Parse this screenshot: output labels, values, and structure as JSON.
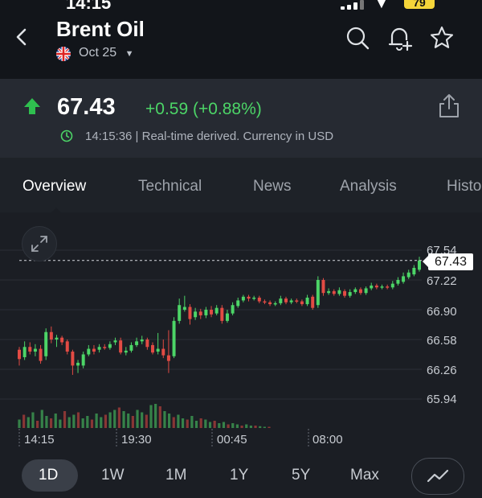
{
  "status_bar": {
    "time": "14:15",
    "battery": "79"
  },
  "header": {
    "title": "Brent Oil",
    "contract": "Oct 25"
  },
  "quote": {
    "price": "67.43",
    "change": "+0.59 (+0.88%)",
    "realtime_text": "14:15:36 | Real-time derived. Currency in USD",
    "colors": {
      "up": "#4cd567",
      "down": "#e34b44"
    }
  },
  "tabs": [
    "Overview",
    "Technical",
    "News",
    "Analysis",
    "Histo"
  ],
  "chart_data": {
    "type": "candlestick",
    "price_tag": "67.43",
    "y_ticks": [
      "67.54",
      "67.22",
      "66.90",
      "66.58",
      "66.26",
      "65.94"
    ],
    "x_ticks": [
      "14:15",
      "19:30",
      "00:45",
      "08:00"
    ],
    "ylim": [
      65.94,
      67.54
    ],
    "grid": true,
    "candles": [
      {
        "o": 66.47,
        "c": 66.37,
        "h": 66.5,
        "l": 66.3
      },
      {
        "o": 66.39,
        "c": 66.5,
        "h": 66.56,
        "l": 66.36
      },
      {
        "o": 66.5,
        "c": 66.45,
        "h": 66.55,
        "l": 66.42
      },
      {
        "o": 66.45,
        "c": 66.48,
        "h": 66.53,
        "l": 66.4
      },
      {
        "o": 66.48,
        "c": 66.35,
        "h": 66.52,
        "l": 66.32
      },
      {
        "o": 66.4,
        "c": 66.66,
        "h": 66.7,
        "l": 66.36
      },
      {
        "o": 66.66,
        "c": 66.58,
        "h": 66.72,
        "l": 66.54
      },
      {
        "o": 66.58,
        "c": 66.6,
        "h": 66.63,
        "l": 66.5
      },
      {
        "o": 66.6,
        "c": 66.55,
        "h": 66.62,
        "l": 66.52
      },
      {
        "o": 66.56,
        "c": 66.45,
        "h": 66.58,
        "l": 66.42
      },
      {
        "o": 66.45,
        "c": 66.3,
        "h": 66.47,
        "l": 66.2
      },
      {
        "o": 66.3,
        "c": 66.33,
        "h": 66.36,
        "l": 66.22
      },
      {
        "o": 66.3,
        "c": 66.42,
        "h": 66.45,
        "l": 66.27
      },
      {
        "o": 66.42,
        "c": 66.48,
        "h": 66.52,
        "l": 66.4
      },
      {
        "o": 66.48,
        "c": 66.45,
        "h": 66.52,
        "l": 66.42
      },
      {
        "o": 66.47,
        "c": 66.5,
        "h": 66.53,
        "l": 66.44
      },
      {
        "o": 66.5,
        "c": 66.49,
        "h": 66.53,
        "l": 66.47
      },
      {
        "o": 66.49,
        "c": 66.53,
        "h": 66.56,
        "l": 66.47
      },
      {
        "o": 66.55,
        "c": 66.57,
        "h": 66.6,
        "l": 66.52
      },
      {
        "o": 66.57,
        "c": 66.44,
        "h": 66.6,
        "l": 66.42
      },
      {
        "o": 66.44,
        "c": 66.46,
        "h": 66.5,
        "l": 66.41
      },
      {
        "o": 66.46,
        "c": 66.52,
        "h": 66.55,
        "l": 66.44
      },
      {
        "o": 66.52,
        "c": 66.56,
        "h": 66.6,
        "l": 66.5
      },
      {
        "o": 66.56,
        "c": 66.58,
        "h": 66.62,
        "l": 66.53
      },
      {
        "o": 66.58,
        "c": 66.5,
        "h": 66.6,
        "l": 66.47
      },
      {
        "o": 66.52,
        "c": 66.44,
        "h": 66.55,
        "l": 66.42
      },
      {
        "o": 66.45,
        "c": 66.48,
        "h": 66.65,
        "l": 66.42
      },
      {
        "o": 66.48,
        "c": 66.41,
        "h": 66.58,
        "l": 66.38
      },
      {
        "o": 66.41,
        "c": 66.35,
        "h": 66.68,
        "l": 66.22
      },
      {
        "o": 66.4,
        "c": 66.78,
        "h": 66.82,
        "l": 66.38
      },
      {
        "o": 66.78,
        "c": 66.95,
        "h": 67.02,
        "l": 66.75
      },
      {
        "o": 66.9,
        "c": 66.93,
        "h": 67.05,
        "l": 66.88
      },
      {
        "o": 66.93,
        "c": 66.8,
        "h": 66.96,
        "l": 66.74
      },
      {
        "o": 66.82,
        "c": 66.88,
        "h": 66.92,
        "l": 66.79
      },
      {
        "o": 66.88,
        "c": 66.84,
        "h": 66.91,
        "l": 66.8
      },
      {
        "o": 66.84,
        "c": 66.9,
        "h": 66.93,
        "l": 66.81
      },
      {
        "o": 66.9,
        "c": 66.85,
        "h": 66.94,
        "l": 66.82
      },
      {
        "o": 66.86,
        "c": 66.92,
        "h": 66.95,
        "l": 66.84
      },
      {
        "o": 66.92,
        "c": 66.78,
        "h": 66.95,
        "l": 66.75
      },
      {
        "o": 66.78,
        "c": 66.86,
        "h": 66.9,
        "l": 66.76
      },
      {
        "o": 66.86,
        "c": 66.95,
        "h": 66.98,
        "l": 66.84
      },
      {
        "o": 66.94,
        "c": 67.0,
        "h": 67.03,
        "l": 66.92
      },
      {
        "o": 67.0,
        "c": 67.04,
        "h": 67.06,
        "l": 66.98
      },
      {
        "o": 67.04,
        "c": 67.02,
        "h": 67.06,
        "l": 66.99
      },
      {
        "o": 67.02,
        "c": 67.03,
        "h": 67.05,
        "l": 67.0
      },
      {
        "o": 67.03,
        "c": 66.99,
        "h": 67.05,
        "l": 66.97
      },
      {
        "o": 66.99,
        "c": 66.98,
        "h": 67.01,
        "l": 66.96
      },
      {
        "o": 66.98,
        "c": 66.96,
        "h": 67.0,
        "l": 66.94
      },
      {
        "o": 66.96,
        "c": 66.97,
        "h": 66.99,
        "l": 66.94
      },
      {
        "o": 66.97,
        "c": 67.02,
        "h": 67.05,
        "l": 66.95
      },
      {
        "o": 67.02,
        "c": 66.98,
        "h": 67.04,
        "l": 66.96
      },
      {
        "o": 66.98,
        "c": 67.0,
        "h": 67.02,
        "l": 66.96
      },
      {
        "o": 67.0,
        "c": 66.99,
        "h": 67.02,
        "l": 66.97
      },
      {
        "o": 66.99,
        "c": 66.96,
        "h": 67.01,
        "l": 66.94
      },
      {
        "o": 66.96,
        "c": 67.03,
        "h": 67.06,
        "l": 66.94
      },
      {
        "o": 67.04,
        "c": 66.92,
        "h": 67.06,
        "l": 66.9
      },
      {
        "o": 66.95,
        "c": 67.22,
        "h": 67.26,
        "l": 66.92
      },
      {
        "o": 67.22,
        "c": 67.08,
        "h": 67.24,
        "l": 67.05
      },
      {
        "o": 67.08,
        "c": 67.1,
        "h": 67.13,
        "l": 67.06
      },
      {
        "o": 67.1,
        "c": 67.07,
        "h": 67.12,
        "l": 67.05
      },
      {
        "o": 67.07,
        "c": 67.11,
        "h": 67.14,
        "l": 67.05
      },
      {
        "o": 67.1,
        "c": 67.05,
        "h": 67.12,
        "l": 67.03
      },
      {
        "o": 67.05,
        "c": 67.09,
        "h": 67.12,
        "l": 67.03
      },
      {
        "o": 67.09,
        "c": 67.12,
        "h": 67.14,
        "l": 67.07
      },
      {
        "o": 67.12,
        "c": 67.08,
        "h": 67.14,
        "l": 67.06
      },
      {
        "o": 67.08,
        "c": 67.13,
        "h": 67.15,
        "l": 67.06
      },
      {
        "o": 67.13,
        "c": 67.16,
        "h": 67.19,
        "l": 67.11
      },
      {
        "o": 67.16,
        "c": 67.14,
        "h": 67.18,
        "l": 67.12
      },
      {
        "o": 67.14,
        "c": 67.15,
        "h": 67.17,
        "l": 67.12
      },
      {
        "o": 67.15,
        "c": 67.14,
        "h": 67.17,
        "l": 67.12
      },
      {
        "o": 67.14,
        "c": 67.18,
        "h": 67.21,
        "l": 67.12
      },
      {
        "o": 67.18,
        "c": 67.22,
        "h": 67.25,
        "l": 67.16
      },
      {
        "o": 67.2,
        "c": 67.26,
        "h": 67.3,
        "l": 67.18
      },
      {
        "o": 67.25,
        "c": 67.3,
        "h": 67.33,
        "l": 67.23
      },
      {
        "o": 67.28,
        "c": 67.35,
        "h": 67.38,
        "l": 67.26
      },
      {
        "o": 67.33,
        "c": 67.43,
        "h": 67.47,
        "l": 67.31
      }
    ],
    "volumes": [
      14,
      22,
      18,
      26,
      12,
      30,
      20,
      16,
      24,
      14,
      28,
      18,
      22,
      26,
      16,
      20,
      14,
      24,
      18,
      22,
      26,
      30,
      34,
      28,
      24,
      20,
      30,
      26,
      22,
      38,
      40,
      36,
      28,
      24,
      18,
      22,
      16,
      14,
      20,
      12,
      16,
      14,
      10,
      12,
      8,
      10,
      6,
      8,
      6,
      4,
      6,
      4,
      4,
      3,
      2,
      2
    ]
  },
  "ranges": [
    "1D",
    "1W",
    "1M",
    "1Y",
    "5Y",
    "Max"
  ]
}
